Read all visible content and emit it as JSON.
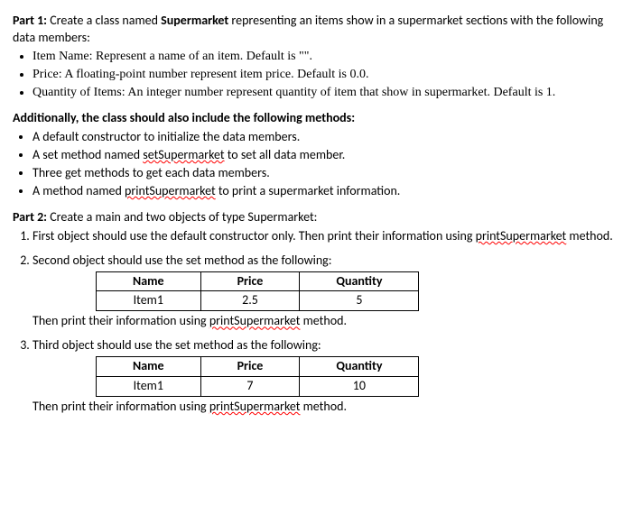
{
  "part1": {
    "heading_label": "Part 1:",
    "heading_text": " Create a class named ",
    "class_name": "Supermarket",
    "heading_cont": " representing an items show in a supermarket sections with the following data members:",
    "bullets": [
      {
        "label": "Item Name: Represent a name of an item. Default is \"\"."
      },
      {
        "label": "Price: A floating-point number represent item price. Default is 0.0."
      },
      {
        "label": "Quantity of Items: An integer number represent quantity of item that show in supermarket. Default is 1."
      }
    ],
    "additional_heading": "Additionally, the class should also include the following methods:",
    "methods": [
      {
        "pre": "A default constructor to initialize the data members.",
        "wavy": "",
        "post": ""
      },
      {
        "pre": "A set method named ",
        "wavy": "setSupermarket",
        "post": " to set all data member."
      },
      {
        "pre": "Three get methods to get each data members.",
        "wavy": "",
        "post": ""
      },
      {
        "pre": "A method named ",
        "wavy": "printSupermarket",
        "post": " to print a supermarket information."
      }
    ]
  },
  "part2": {
    "heading_label": "Part 2:",
    "heading_text": " Create a main and two objects of type Supermarket:",
    "item1_pre": "First object should use the default constructor only. Then print their information using ",
    "item1_wavy": "printSupermarket",
    "item1_post": " method.",
    "item2_pre": "Second object should use the set method as the following:",
    "table2": {
      "h1": "Name",
      "h2": "Price",
      "h3": "Quantity",
      "c1": "Item1",
      "c2": "2.5",
      "c3": "5"
    },
    "item2_after_pre": "Then print their information using ",
    "item2_after_wavy": "printSupermarket",
    "item2_after_post": " method.",
    "item3_pre": "Third object should use the set method as the following:",
    "table3": {
      "h1": "Name",
      "h2": "Price",
      "h3": "Quantity",
      "c1": "Item1",
      "c2": "7",
      "c3": "10"
    },
    "item3_after_pre": "Then print their information using ",
    "item3_after_wavy": "printSupermarket",
    "item3_after_post": " method."
  }
}
